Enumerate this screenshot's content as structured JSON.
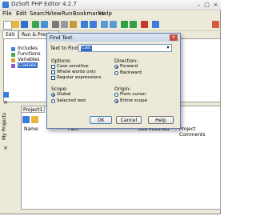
{
  "window": {
    "title": "DzSoft PHP Editor 4.2.7",
    "controls": [
      "minimize-icon",
      "maximize-icon",
      "close-icon"
    ]
  },
  "menu": [
    "File",
    "Edit",
    "Search",
    "View",
    "Run",
    "Bookmarks",
    "Help"
  ],
  "side_tabs": [
    "Edit",
    "Run & Preview"
  ],
  "tree": [
    "Includes",
    "Functions",
    "Variables",
    "Classes"
  ],
  "projects": {
    "vertical_label": "My Projects",
    "tab": "Project1",
    "columns": [
      "Name",
      "Path",
      "Size",
      "Modified",
      "Project Comments"
    ]
  },
  "dialog": {
    "title": "Find Text",
    "find_label": "Text to Find",
    "find_value": "Calc",
    "options_heading": "Options:",
    "options": [
      "Case sensitive",
      "Whole words only",
      "Regular expressions"
    ],
    "direction_heading": "Direction:",
    "direction": [
      "Forward",
      "Backward"
    ],
    "direction_selected": "Forward",
    "scope_heading": "Scope:",
    "scope": [
      "Global",
      "Selected text"
    ],
    "scope_selected": "Global",
    "origin_heading": "Origin:",
    "origin": [
      "From cursor",
      "Entire scope"
    ],
    "origin_selected": "Entire scope",
    "buttons": {
      "ok": "OK",
      "cancel": "Cancel",
      "help": "Help"
    }
  },
  "colors": {
    "selection": "#316ac5",
    "dialog_border": "#5a7fb5",
    "close": "#c74e3f"
  }
}
